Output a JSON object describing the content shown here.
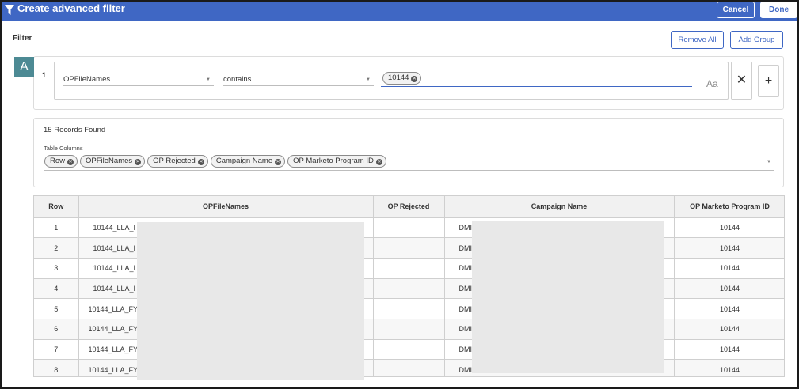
{
  "header": {
    "title": "Create advanced filter",
    "cancel_label": "Cancel",
    "done_label": "Done",
    "icon": "filter-icon",
    "bg_color": "#3f67c4"
  },
  "filter": {
    "label": "Filter",
    "remove_all_label": "Remove All",
    "add_group_label": "Add Group"
  },
  "group": {
    "badge": "A",
    "badge_color": "#4d8a94",
    "rule": {
      "number": "1",
      "field": "OPFileNames",
      "operator": "contains",
      "value_chip": "10144",
      "case_toggle": "Aa"
    }
  },
  "records": {
    "count_text": "15 Records Found",
    "table_columns_label": "Table Columns",
    "columns": [
      "Row",
      "OPFileNames",
      "OP Rejected",
      "Campaign Name",
      "OP Marketo Program ID"
    ]
  },
  "table": {
    "headers": [
      "Row",
      "OPFileNames",
      "OP Rejected",
      "Campaign Name",
      "OP Marketo Program ID"
    ],
    "rows": [
      {
        "row": "1",
        "file": "10144_LLA_I",
        "rejected": "",
        "campaign": "DMI",
        "program_id": "10144"
      },
      {
        "row": "2",
        "file": "10144_LLA_I",
        "rejected": "",
        "campaign": "DMI",
        "program_id": "10144"
      },
      {
        "row": "3",
        "file": "10144_LLA_I",
        "rejected": "",
        "campaign": "DMI",
        "program_id": "10144"
      },
      {
        "row": "4",
        "file": "10144_LLA_I",
        "rejected": "",
        "campaign": "DMI",
        "program_id": "10144"
      },
      {
        "row": "5",
        "file": "10144_LLA_FY",
        "rejected": "",
        "campaign": "DMI",
        "program_id": "10144"
      },
      {
        "row": "6",
        "file": "10144_LLA_FY",
        "rejected": "",
        "campaign": "DMI",
        "program_id": "10144"
      },
      {
        "row": "7",
        "file": "10144_LLA_FY",
        "rejected": "",
        "campaign": "DMI",
        "program_id": "10144"
      },
      {
        "row": "8",
        "file": "10144_LLA_FY",
        "rejected": "",
        "campaign": "DMI",
        "program_id": "10144"
      }
    ]
  }
}
